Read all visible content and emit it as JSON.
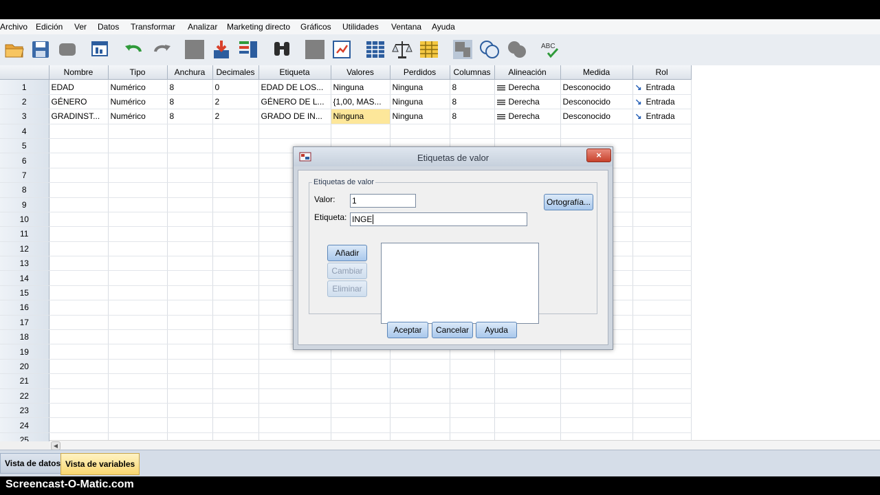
{
  "menu": [
    "Archivo",
    "Edición",
    "Ver",
    "Datos",
    "Transformar",
    "Analizar",
    "Marketing directo",
    "Gráficos",
    "Utilidades",
    "Ventana",
    "Ayuda"
  ],
  "toolbar_icons": [
    "open-folder-icon",
    "save-icon",
    "print-icon",
    "recall-dialog-icon",
    "undo-icon",
    "redo-icon",
    "goto-case-icon",
    "goto-variable-icon",
    "variables-icon",
    "find-icon",
    "insert-cases-icon",
    "insert-variable-icon",
    "split-file-icon",
    "weight-cases-icon",
    "select-cases-icon",
    "value-labels-icon",
    "use-sets-icon",
    "show-all-variables-icon",
    "spell-check-icon"
  ],
  "grid": {
    "columns": [
      "Nombre",
      "Tipo",
      "Anchura",
      "Decimales",
      "Etiqueta",
      "Valores",
      "Perdidos",
      "Columnas",
      "Alineación",
      "Medida",
      "Rol"
    ],
    "rows": [
      {
        "num": "1",
        "nombre": "EDAD",
        "tipo": "Numérico",
        "anchura": "8",
        "decimales": "0",
        "etiqueta": "EDAD DE LOS...",
        "valores": "Ninguna",
        "perdidos": "Ninguna",
        "columnas": "8",
        "alineacion": "Derecha",
        "medida": "Desconocido",
        "rol": "Entrada"
      },
      {
        "num": "2",
        "nombre": "GÉNERO",
        "tipo": "Numérico",
        "anchura": "8",
        "decimales": "2",
        "etiqueta": "GÉNERO DE L...",
        "valores": "{1,00, MAS...",
        "perdidos": "Ninguna",
        "columnas": "8",
        "alineacion": "Derecha",
        "medida": "Desconocido",
        "rol": "Entrada"
      },
      {
        "num": "3",
        "nombre": "GRADINST...",
        "tipo": "Numérico",
        "anchura": "8",
        "decimales": "2",
        "etiqueta": "GRADO DE IN...",
        "valores": "Ninguna",
        "perdidos": "Ninguna",
        "columnas": "8",
        "alineacion": "Derecha",
        "medida": "Desconocido",
        "rol": "Entrada"
      }
    ],
    "empty_row_numbers": [
      "4",
      "5",
      "6",
      "7",
      "8",
      "9",
      "10",
      "11",
      "12",
      "13",
      "14",
      "15",
      "16",
      "17",
      "18",
      "19",
      "20",
      "21",
      "22",
      "23",
      "24",
      "25"
    ],
    "selected_cell": {
      "row": "3",
      "column": "Valores"
    }
  },
  "tabs": {
    "datos": "Vista de datos",
    "variables": "Vista de variables",
    "active": "Vista de variables"
  },
  "footer": "Screencast-O-Matic.com",
  "dialog": {
    "title": "Etiquetas de valor",
    "close_label": "×",
    "group_label": "Etiquetas de valor",
    "valor_label": "Valor:",
    "valor_value": "1",
    "etiqueta_label": "Etiqueta:",
    "etiqueta_value": "INGE",
    "ortografia_button": "Ortografía...",
    "anadir_button": "Añadir",
    "cambiar_button": "Cambiar",
    "eliminar_button": "Eliminar",
    "aceptar_button": "Aceptar",
    "cancelar_button": "Cancelar",
    "ayuda_button": "Ayuda"
  },
  "colors": {
    "selected_cell": "#fde79a",
    "active_tab": "#f8d66f",
    "button": "#a9c8ec"
  }
}
